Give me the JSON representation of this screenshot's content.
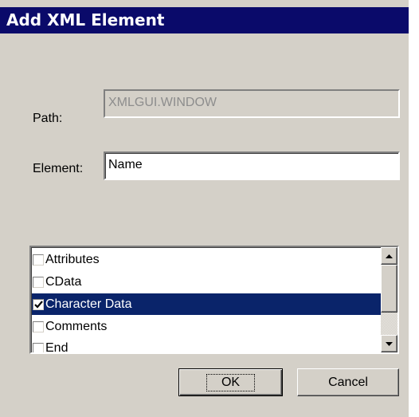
{
  "dialog": {
    "title": "Add XML Element"
  },
  "form": {
    "path_label": "Path:",
    "path_value": "XMLGUI.WINDOW",
    "element_label": "Element:",
    "element_value": "Name"
  },
  "list": {
    "items": [
      {
        "label": "Attributes",
        "checked": false,
        "selected": false
      },
      {
        "label": "CData",
        "checked": false,
        "selected": false
      },
      {
        "label": "Character Data",
        "checked": true,
        "selected": true
      },
      {
        "label": "Comments",
        "checked": false,
        "selected": false
      },
      {
        "label": "End",
        "checked": false,
        "selected": false
      }
    ]
  },
  "buttons": {
    "ok_label": "OK",
    "cancel_label": "Cancel"
  },
  "colors": {
    "title_bar": "#0a0a6a",
    "dialog_face": "#d4d0c8",
    "selection": "#0a246a"
  },
  "icons": {
    "scroll_up": "triangle-up-icon",
    "scroll_down": "triangle-down-icon",
    "checkmark": "checkmark-icon"
  }
}
